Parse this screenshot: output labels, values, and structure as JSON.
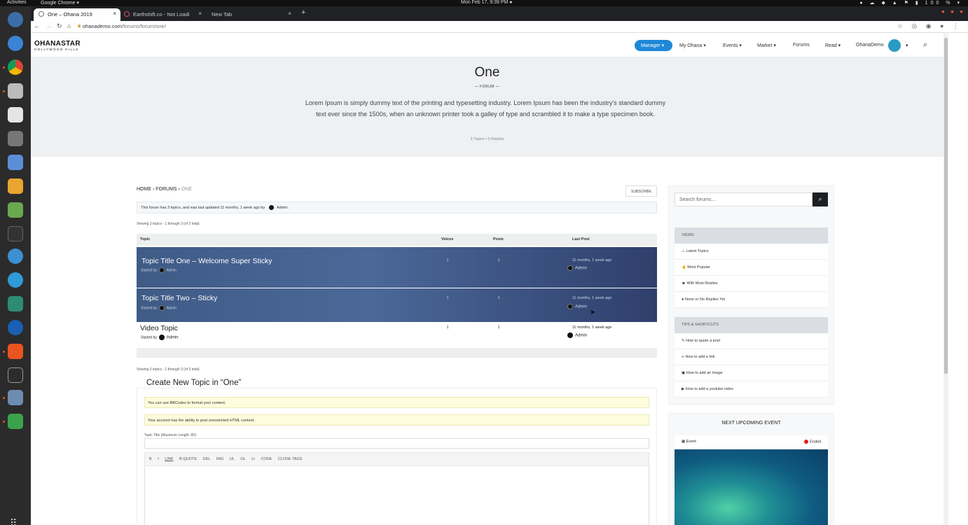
{
  "os": {
    "activities": "Activities",
    "app_menu": "Google Chrome ▾",
    "clock": "Mon Feb 17,  9:39 PM ●",
    "tray": "● ☁ ◆ ▲ ⚑ ▮ 100 % ▾"
  },
  "browser": {
    "tabs": [
      {
        "label": "One – Ohana 2019",
        "close": "×"
      },
      {
        "label": "Earthshift.co - Not Loadi",
        "close": "×"
      },
      {
        "label": "New Tab",
        "close": "×"
      }
    ],
    "new_tab": "+",
    "url_host": "ohanademo.com",
    "url_path": "/forums/forum/one/",
    "nav": {
      "back": "←",
      "forward": "→",
      "reload": "↻",
      "home": "⌂",
      "lock": "🔒"
    },
    "ext_icons": "☆ ◎ ◉ ● ⋮"
  },
  "site": {
    "logo_main": "OHANASTAR",
    "logo_sub": "HOLLYWOOD HILLS",
    "nav": {
      "manager": "Manager ▾",
      "my_ohana": "My Ohana ▾",
      "events": "Events ▾",
      "market": "Market ▾",
      "forums": "Forums",
      "read": "Read ▾",
      "user": "OhanaDemo",
      "user_caret": "▾",
      "search": "⌕"
    }
  },
  "hero": {
    "title": "One",
    "subtitle": "—  FORUM  —",
    "description": "Lorem Ipsum is simply dummy text of the printing and typesetting industry. Lorem Ipsum has been the industry's standard dummy text ever since the 1500s, when an unknown printer took a galley of type and scrambled it to make a type specimen book.",
    "counts": "3 Topics • 0 Replies"
  },
  "forum": {
    "breadcrumb_home": "HOME",
    "breadcrumb_sep": "›",
    "breadcrumb_forums": "FORUMS",
    "breadcrumb_current": "ONE",
    "subscribe": "SUBSCRIBE",
    "notice": "This forum has 3 topics, and was last updated 11 months, 1 week ago by",
    "notice_author": "Admin.",
    "viewing": "Viewing 3 topics - 1 through 3 (of 3 total)",
    "columns": {
      "topic": "Topic",
      "voices": "Voices",
      "posts": "Posts",
      "last_post": "Last Post"
    },
    "started_by": "Started by:",
    "topics": [
      {
        "title": "Topic Title One – Welcome Super Sticky",
        "author": "Admin",
        "voices": "1",
        "posts": "1",
        "freshness": "11 months, 1 week ago",
        "last_author": "Admin"
      },
      {
        "title": "Topic Title Two – Sticky",
        "author": "Admin",
        "voices": "1",
        "posts": "1",
        "freshness": "11 months, 1 week ago",
        "last_author": "Admin"
      },
      {
        "title": "Video Topic",
        "author": "Admin",
        "voices": "1",
        "posts": "1",
        "freshness": "11 months, 1 week ago",
        "last_author": "Admin"
      }
    ]
  },
  "create": {
    "legend": "Create New Topic in “One”",
    "bbcode_note": "You can use BBCodes to format your content.",
    "html_note": "Your account has the ability to post unrestricted HTML content.",
    "title_label": "Topic Title (Maximum Length: 80):",
    "toolbar": [
      "B",
      "I",
      "LINK",
      "B-QUOTE",
      "DEL",
      "IMG",
      "UL",
      "OL",
      "LI",
      "CODE",
      "CLOSE TAGS"
    ]
  },
  "sidebar": {
    "search_placeholder": "Search forums...",
    "search_icon": "⌕",
    "views_heading": "VIEWS",
    "views": [
      "Latest Topics",
      "Most Popular",
      "With Most Replies",
      "None or No Replies Yet"
    ],
    "tips_heading": "TIPS & SHORTCUTS",
    "tips": [
      "How to quote a post",
      "How to add a link",
      "How to add an image",
      "How to add a youtube video"
    ],
    "event_heading": "NEXT UPCOMING EVENT",
    "event_label": "Event",
    "event_status": "Ended"
  }
}
